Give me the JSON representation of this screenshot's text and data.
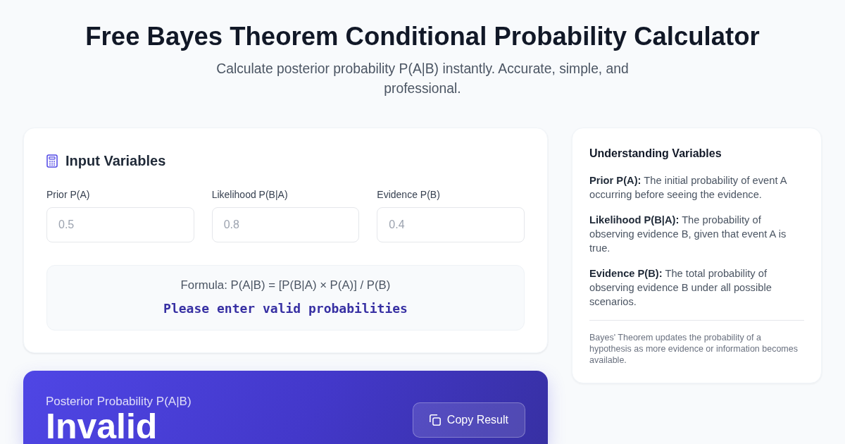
{
  "header": {
    "title": "Free Bayes Theorem Conditional Probability Calculator",
    "subtitle": "Calculate posterior probability P(A|B) instantly. Accurate, simple, and professional."
  },
  "input_card": {
    "title": "Input Variables",
    "fields": [
      {
        "label": "Prior P(A)",
        "placeholder": "0.5"
      },
      {
        "label": "Likelihood P(B|A)",
        "placeholder": "0.8"
      },
      {
        "label": "Evidence P(B)",
        "placeholder": "0.4"
      }
    ],
    "formula": "Formula: P(A|B) = [P(B|A) × P(A)] / P(B)",
    "message": "Please enter valid probabilities"
  },
  "result": {
    "label": "Posterior Probability P(A|B)",
    "value": "Invalid",
    "button": "Copy Result"
  },
  "sidebar": {
    "title": "Understanding Variables",
    "definitions": [
      "**Prior P(A):** The initial probability of event A occurring before seeing the evidence.",
      "**Likelihood P(B|A):** The probability of observing evidence B, given that event A is true.",
      "**Evidence P(B):** The total probability of observing evidence B under all possible scenarios."
    ],
    "note": "Bayes' Theorem updates the probability of a hypothesis as more evidence or information becomes available."
  }
}
